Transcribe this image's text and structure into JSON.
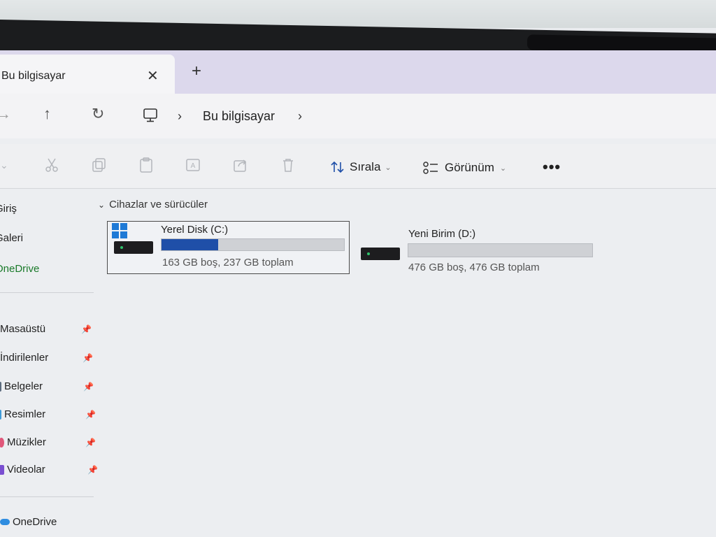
{
  "tab": {
    "title": "Bu bilgisayar",
    "close_glyph": "✕",
    "new_glyph": "+"
  },
  "breadcrumb": {
    "current": "Bu bilgisayar"
  },
  "toolbar": {
    "sort_label": "Sırala",
    "view_label": "Görünüm",
    "more_label": "•••"
  },
  "sidebar": {
    "quick": [
      {
        "label": "Giriş",
        "icon": "home-icon"
      },
      {
        "label": "Galeri",
        "icon": "gallery-icon"
      },
      {
        "label": "OneDrive",
        "icon": "onedrive-icon"
      }
    ],
    "pinned": [
      {
        "label": "Masaüstü",
        "icon": "desktop-folder-icon",
        "color": "#4a90d9"
      },
      {
        "label": "İndirilenler",
        "icon": "downloads-folder-icon",
        "color": "#2f7fd1"
      },
      {
        "label": "Belgeler",
        "icon": "documents-folder-icon",
        "color": "#5b6b7d"
      },
      {
        "label": "Resimler",
        "icon": "pictures-folder-icon",
        "color": "#3f9bd8"
      },
      {
        "label": "Müzikler",
        "icon": "music-folder-icon",
        "color": "#e0577a"
      },
      {
        "label": "Videolar",
        "icon": "videos-folder-icon",
        "color": "#7a4fd1"
      }
    ],
    "bottom": {
      "label": "OneDrive",
      "icon": "onedrive-icon"
    }
  },
  "content": {
    "group_label": "Cihazlar ve sürücüler",
    "drives": [
      {
        "name": "Yerel Disk (C:)",
        "info": "163 GB boş, 237 GB toplam",
        "used_fraction": 0.312
      },
      {
        "name": "Yeni Birim (D:)",
        "info": "476 GB boş, 476 GB toplam",
        "used_fraction": 0.0
      }
    ]
  },
  "colors": {
    "accent": "#1f4fa8",
    "tabbar": "#dcd8ec"
  }
}
